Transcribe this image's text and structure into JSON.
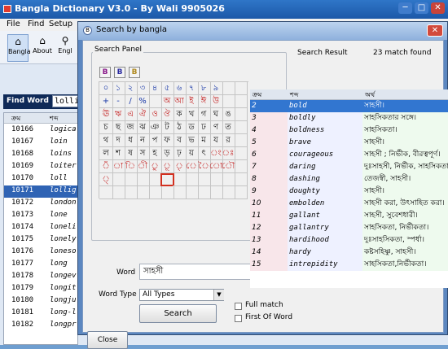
{
  "main_window": {
    "title": "Bangla Dictionary V3.0 - By Wali 9905026",
    "controls": {
      "minimize": "─",
      "maximize": "□",
      "close": "✕"
    },
    "menu": [
      "File",
      "Find",
      "Setup"
    ],
    "toolbar": [
      {
        "label": "Bangla",
        "icon": "bangla-icon",
        "glyph": "⌂"
      },
      {
        "label": "About",
        "icon": "about-icon",
        "glyph": "⌂"
      },
      {
        "label": "Engl",
        "icon": "search-icon",
        "glyph": "⚲"
      }
    ],
    "find_word": {
      "label": "Find Word",
      "value": "lolli"
    },
    "list": {
      "columns": [
        "ক্রম",
        "শব্দ"
      ],
      "rows": [
        {
          "id": "10166",
          "word": "logica"
        },
        {
          "id": "10167",
          "word": "loin"
        },
        {
          "id": "10168",
          "word": "loins"
        },
        {
          "id": "10169",
          "word": "loiter"
        },
        {
          "id": "10170",
          "word": "loll"
        },
        {
          "id": "10171",
          "word": "lollig",
          "selected": true
        },
        {
          "id": "10172",
          "word": "london"
        },
        {
          "id": "10173",
          "word": "lone"
        },
        {
          "id": "10174",
          "word": "loneli"
        },
        {
          "id": "10175",
          "word": "lonely"
        },
        {
          "id": "10176",
          "word": "loneso"
        },
        {
          "id": "10177",
          "word": "long"
        },
        {
          "id": "10178",
          "word": "longev"
        },
        {
          "id": "10179",
          "word": "longit"
        },
        {
          "id": "10180",
          "word": "longju"
        },
        {
          "id": "10181",
          "word": "long-l"
        },
        {
          "id": "10182",
          "word": "longpr"
        }
      ]
    }
  },
  "dialog": {
    "title": "Search by bangla",
    "close_label": "✕",
    "search_panel_label": "Search Panel",
    "format_buttons": [
      "B",
      "B",
      "B"
    ],
    "keyboard_rows": [
      [
        "০",
        "১",
        "২",
        "৩",
        "৪",
        "৫",
        "৬",
        "৭",
        "৮",
        "৯",
        "",
        ""
      ],
      [
        "+",
        "-",
        "/",
        "%",
        "",
        "অ",
        "আ",
        "ই",
        "ঈ",
        "উ",
        "",
        ""
      ],
      [
        "ঊ",
        "ঋ",
        "এ",
        "ঐ",
        "ও",
        "ঔ",
        "ক",
        "খ",
        "গ",
        "ঘ",
        "ঙ",
        ""
      ],
      [
        "চ",
        "ছ",
        "জ",
        "ঝ",
        "ঞ",
        "ট",
        "ঠ",
        "ড",
        "ঢ",
        "ণ",
        "ত",
        ""
      ],
      [
        "থ",
        "দ",
        "ধ",
        "ন",
        "প",
        "ফ",
        "ব",
        "ভ",
        "ম",
        "য",
        "র",
        ""
      ],
      [
        "ল",
        "শ",
        "ষ",
        "স",
        "হ",
        "ড়",
        "ঢ়",
        "য়",
        "ৎ",
        "ং",
        "ঃ",
        ""
      ],
      [
        "ঁ",
        "া",
        "ি",
        "ী",
        "ু",
        "ূ",
        "ৃ",
        "ে",
        "ৈ",
        "ো",
        "ৌ",
        ""
      ],
      [
        "্",
        "",
        "",
        "",
        "",
        "",
        "",
        "",
        "",
        "",
        "",
        ""
      ],
      [
        "",
        "",
        "",
        "",
        "",
        "",
        "",
        "",
        "",
        "",
        "",
        ""
      ]
    ],
    "selected_key": {
      "row": 7,
      "col": 5
    },
    "word_label": "Word",
    "word_value": "সাহসী",
    "word_type_label": "Word Type",
    "word_type_value": "All Types",
    "full_match_label": "Full match",
    "first_of_word_label": "First Of Word",
    "search_button": "Search",
    "close_button": "Close",
    "result_label": "Search Result",
    "match_count": "23 match found",
    "results": {
      "columns": [
        "ক্রম",
        "শব্দ",
        "অর্থ"
      ],
      "rows": [
        {
          "n": "2",
          "word": "bold",
          "meaning": "সাহসী।",
          "selected": true
        },
        {
          "n": "3",
          "word": "boldly",
          "meaning": "সাহসিকতার সঙ্গে।"
        },
        {
          "n": "4",
          "word": "boldness",
          "meaning": "সাহসিকতা।"
        },
        {
          "n": "5",
          "word": "brave",
          "meaning": "সাহসী।"
        },
        {
          "n": "6",
          "word": "courageous",
          "meaning": "সাহসী ; নির্ভীক, বীরত্বপূর্ণ।"
        },
        {
          "n": "7",
          "word": "daring",
          "meaning": "দুঃসাহসী, নির্ভীক, সাহসিকতা।"
        },
        {
          "n": "8",
          "word": "dashing",
          "meaning": "তেজস্বী, সাহসী।"
        },
        {
          "n": "9",
          "word": "doughty",
          "meaning": "সাহসী।"
        },
        {
          "n": "10",
          "word": "embolden",
          "meaning": "সাহসী করা, উৎসাহিত করা।"
        },
        {
          "n": "11",
          "word": "gallant",
          "meaning": "সাহসী, সুবেশধারী।"
        },
        {
          "n": "12",
          "word": "gallantry",
          "meaning": "সাহসিকতা, নির্ভীকতা।"
        },
        {
          "n": "13",
          "word": "hardihood",
          "meaning": "দুঃসাহসিকতা, স্পর্ধা।"
        },
        {
          "n": "14",
          "word": "hardy",
          "meaning": "কষ্টসহিষ্ণু, সাহসী।"
        },
        {
          "n": "15",
          "word": "intrepidity",
          "meaning": "সাহসিকতা,নির্ভীকতা।"
        }
      ]
    }
  },
  "colors": {
    "accent": "#2f63b4",
    "row_select": "#3276d0",
    "keyboard_glyph_red": "#c21818",
    "keyboard_glyph_blue": "#1b3aa8",
    "keyboard_glyph_black": "#111111"
  }
}
